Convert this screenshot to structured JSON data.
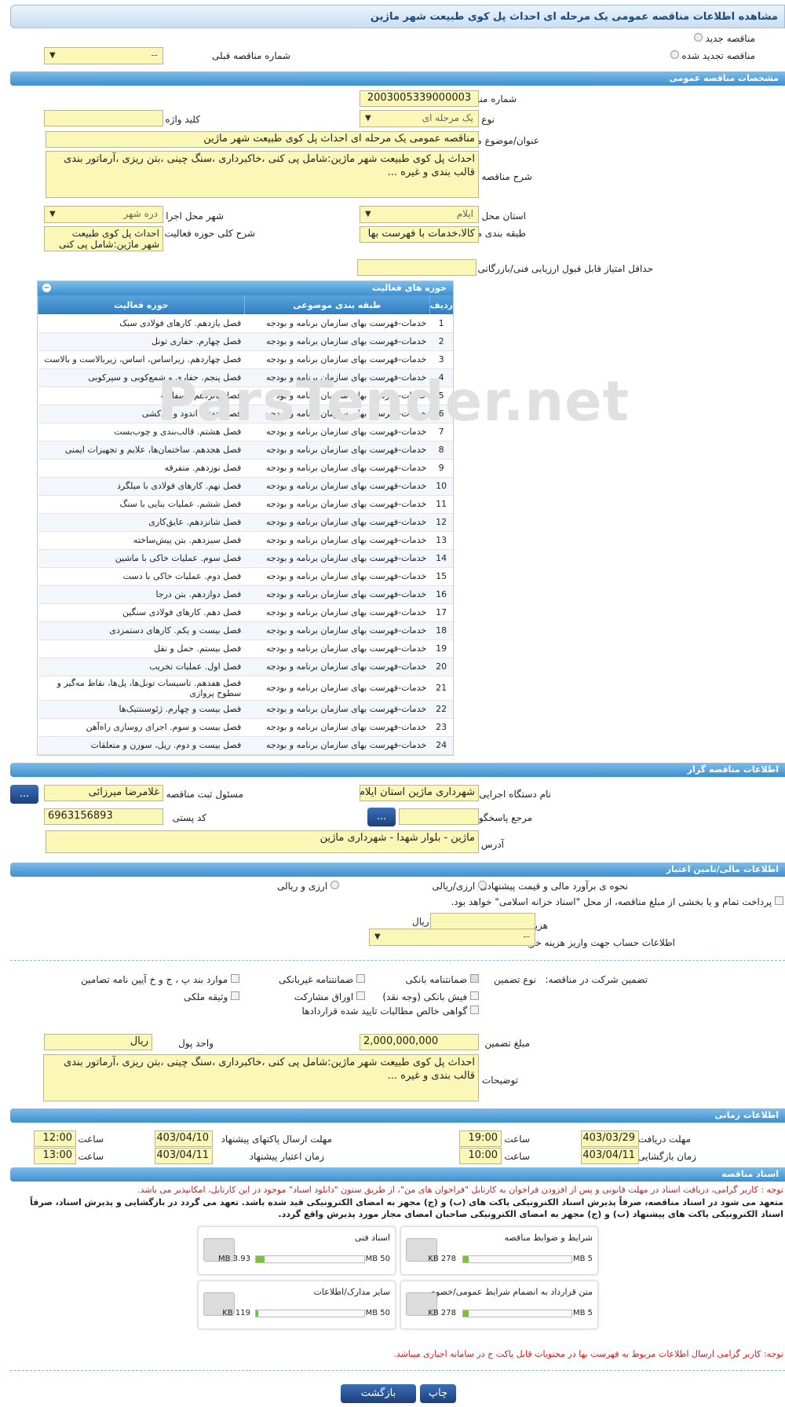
{
  "title": "مشاهده اطلاعات مناقصه عمومی یک مرحله ای احداث پل کوی طبیعت شهر ماژین",
  "top": {
    "new_label": "مناقصه جدید",
    "renewed_label": "مناقصه تجدید شده",
    "prev_label": "شماره مناقصه قبلی",
    "prev_value": "--"
  },
  "sections": {
    "general": "مشخصات مناقصه عمومی",
    "organizer": "اطلاعات مناقصه گزار",
    "finance": "اطلاعات مالی/تامین اعتبار",
    "time": "اطلاعات زمانی",
    "docs": "اسناد مناقصه"
  },
  "general": {
    "number_label": "شماره مناقصه",
    "number": "2003005339000003",
    "type_label": "نوع برگزاری",
    "type": "یک مرحله ای",
    "keyword_label": "کلید واژه",
    "keyword": "",
    "subject_label": "عنوان/موضوع مناقصه",
    "subject": "مناقصه عمومی یک مرحله ای احداث پل کوی طبیعت شهر ماژین",
    "desc_label": "شرح مناقصه",
    "desc": "احداث پل کوی طبیعت شهر ماژین:شامل پی کنی ،خاکبرداری ،سنگ چینی ،بتن ریزی ،آرماتور بندی قالب بندی و غیره ...",
    "province_label": "استان محل اجرا",
    "province": "ایلام",
    "city_label": "شهر محل اجرا",
    "city": "دره شهر",
    "category_label": "طبقه بندی موضوعی",
    "category": "کالا،خدمات با فهرست بها",
    "activity_label": "شرح کلی حوزه فعالیت",
    "activity": "احداث پل کوی طبیعت شهر ماژین:شامل پی کنی",
    "minscore_label": "حداقل امتیاز قابل قبول ارزیابی فنی/بازرگانی",
    "minscore": ""
  },
  "activity_table": {
    "title": "حوزه های فعالیت",
    "headers": [
      "ردیف",
      "طبقه بندی موضوعی",
      "حوزه فعالیت"
    ],
    "rows": [
      [
        "1",
        "خدمات-فهرست بهای سازمان برنامه و بودجه",
        "فصل یازدهم. کارهای فولادی سبک"
      ],
      [
        "2",
        "خدمات-فهرست بهای سازمان برنامه و بودجه",
        "فصل چهارم. حفاری تونل"
      ],
      [
        "3",
        "خدمات-فهرست بهای سازمان برنامه و بودجه",
        "فصل چهاردهم. زیراساس، اساس، زیربالاست و بالاست"
      ],
      [
        "4",
        "خدمات-فهرست بهای سازمان برنامه و بودجه",
        "فصل پنجم. حفاری و شمع‌کوبی و سپرکوبی"
      ],
      [
        "5",
        "خدمات-فهرست بهای سازمان برنامه و بودجه",
        "فصل پانزدهم. آسفالت"
      ],
      [
        "6",
        "خدمات-فهرست بهای سازمان برنامه و بودجه",
        "فصل هفتم. اندود و بندکشی"
      ],
      [
        "7",
        "خدمات-فهرست بهای سازمان برنامه و بودجه",
        "فصل هشتم. قالب‌بندی و چوب‌بست"
      ],
      [
        "8",
        "خدمات-فهرست بهای سازمان برنامه و بودجه",
        "فصل هجدهم. ساختمان‌ها، علایم و تجهیزات ایمنی"
      ],
      [
        "9",
        "خدمات-فهرست بهای سازمان برنامه و بودجه",
        "فصل نوزدهم. متفرقه"
      ],
      [
        "10",
        "خدمات-فهرست بهای سازمان برنامه و بودجه",
        "فصل نهم. کارهای فولادی با میلگرد"
      ],
      [
        "11",
        "خدمات-فهرست بهای سازمان برنامه و بودجه",
        "فصل ششم. عملیات بنایی با سنگ"
      ],
      [
        "12",
        "خدمات-فهرست بهای سازمان برنامه و بودجه",
        "فصل شانزدهم. عایق‌کاری"
      ],
      [
        "13",
        "خدمات-فهرست بهای سازمان برنامه و بودجه",
        "فصل سیزدهم. بتن پیش‌ساخته"
      ],
      [
        "14",
        "خدمات-فهرست بهای سازمان برنامه و بودجه",
        "فصل سوم. عملیات خاکی با ماشین"
      ],
      [
        "15",
        "خدمات-فهرست بهای سازمان برنامه و بودجه",
        "فصل دوم. عملیات خاکی با دست"
      ],
      [
        "16",
        "خدمات-فهرست بهای سازمان برنامه و بودجه",
        "فصل دوازدهم. بتن درجا"
      ],
      [
        "17",
        "خدمات-فهرست بهای سازمان برنامه و بودجه",
        "فصل دهم. کارهای فولادی سنگین"
      ],
      [
        "18",
        "خدمات-فهرست بهای سازمان برنامه و بودجه",
        "فصل بیست و یکم. کارهای دستمزدی"
      ],
      [
        "19",
        "خدمات-فهرست بهای سازمان برنامه و بودجه",
        "فصل بیستم. حمل و نقل"
      ],
      [
        "20",
        "خدمات-فهرست بهای سازمان برنامه و بودجه",
        "فصل اول. عملیات تخریب"
      ],
      [
        "21",
        "خدمات-فهرست بهای سازمان برنامه و بودجه",
        "فصل هفدهم. تاسیسات تونل‌ها، پل‌ها، نقاط مه‌گیر و سطوح پروازی"
      ],
      [
        "22",
        "خدمات-فهرست بهای سازمان برنامه و بودجه",
        "فصل بیست و چهارم. ژئوسنتتیک‌ها"
      ],
      [
        "23",
        "خدمات-فهرست بهای سازمان برنامه و بودجه",
        "فصل بیست و سوم. اجرای روسازی راه‌آهن"
      ],
      [
        "24",
        "خدمات-فهرست بهای سازمان برنامه و بودجه",
        "فصل بیست و دوم. ریل، سوزن و متعلقات"
      ]
    ]
  },
  "organizer": {
    "org_label": "نام دستگاه اجرایی مناقصه گزار",
    "org": "شهرداری ماژین استان ایلام",
    "resp_label": "مسئول ثبت مناقصه",
    "resp": "غلامرضا میرزائی",
    "ref_label": "مرجع پاسخگویی",
    "ref": "",
    "postal_label": "کد پستی",
    "postal": "6963156893",
    "addr_label": "آدرس",
    "addr": "ماژین - بلوار شهدا - شهرداری ماژین",
    "dots": "..."
  },
  "finance": {
    "estimate_label": "نحوه ی برآورد مالی و قیمت پیشنهادی",
    "opt1": "ارزی/ریالی",
    "opt2": "ارزی و ریالی",
    "treasury_text": "پرداخت تمام و یا بخشی از مبلغ مناقصه، از محل \"اسناد خزانه اسلامی\" خواهد بود.",
    "cost_label": "هزینه خرید اسناد",
    "cost_unit": "ریال",
    "cost": "",
    "account_label": "اطلاعات حساب جهت واریز هزینه خرید اسناد",
    "account": "--",
    "guarantee_label": "تضمین شرکت در مناقصه:",
    "gtype_label": "نوع تضمین",
    "g1": "ضمانتنامه بانکی",
    "g2": "ضمانتنامه غیربانکی",
    "g3": "موارد بند پ ، ج و خ آیین نامه تضامین",
    "g4": "فیش بانکی (وجه نقد)",
    "g5": "اوراق مشارکت",
    "g6": "وثیقه ملکی",
    "g7": "گواهی خالص مطالبات تایید شده قراردادها",
    "amount_label": "مبلغ تضمین",
    "amount": "2,000,000,000",
    "currency_label": "واحد پول",
    "currency": "ریال",
    "notes_label": "توضیحات",
    "notes": "احداث پل کوی طبیعت شهر ماژین:شامل پی کنی ،خاکبرداری ،سنگ چینی ،بتن ریزی ،آرماتور بندی قالب بندی و غیره ..."
  },
  "time": {
    "doc_deadline_label": "مهلت دریافت اسناد",
    "doc_deadline": "1403/03/29",
    "t1_label": "ساعت",
    "t1": "19:00",
    "send_deadline_label": "مهلت ارسال پاکتهای پیشنهاد",
    "send_deadline": "1403/04/10",
    "t2_label": "ساعت",
    "t2": "12:00",
    "open_label": "زمان بازگشایی پاکت ها",
    "open": "1403/04/11",
    "t3_label": "ساعت",
    "t3": "10:00",
    "validity_label": "زمان اعتبار پیشنهاد",
    "validity": "1403/04/11",
    "t4_label": "ساعت",
    "t4": "13:00"
  },
  "docs": {
    "note1": "توجه : کاربر گرامی، دریافت اسناد در مهلت قانونی و پس از افزودن فراخوان به کارتابل \"فراخوان های من\"، از طریق ستون \"دانلود اسناد\" موجود در این کارتابل، امکانپذیر می باشد.",
    "note2": "متعهد می شود در اسناد مناقصه، صرفاً پذیرش اسناد الکترونیکی پاکت های (ب) و (ج) مجهز به امضای الکترونیکی قید شده باشد. تعهد می گردد در بازگشایی و پذیرش اسناد، صرفاً اسناد الکترونیکی پاکت های پیشنهاد (ب) و (ج) مجهز به امضای الکترونیکی صاحبان امضای مجاز مورد پذیرش واقع گردد.",
    "files": [
      {
        "name": "شرایط و ضوابط مناقصه",
        "size": "278 KB",
        "max": "5 MB",
        "fill": 0.05
      },
      {
        "name": "اسناد فنی",
        "size": "3.93 MB",
        "max": "50 MB",
        "fill": 0.08
      },
      {
        "name": "متن قرارداد به انضمام شرایط عمومی/خصوصی",
        "size": "278 KB",
        "max": "5 MB",
        "fill": 0.05
      },
      {
        "name": "سایر مدارک/اطلاعات",
        "size": "119 KB",
        "max": "50 MB",
        "fill": 0.02
      }
    ],
    "note3": "توجه: کاربر گرامی ارسال اطلاعات مربوط به فهرست بها در محتویات قابل پاکت ج در سامانه اجباری میباشد."
  },
  "buttons": {
    "back": "بازگشت",
    "print": "چاپ"
  }
}
